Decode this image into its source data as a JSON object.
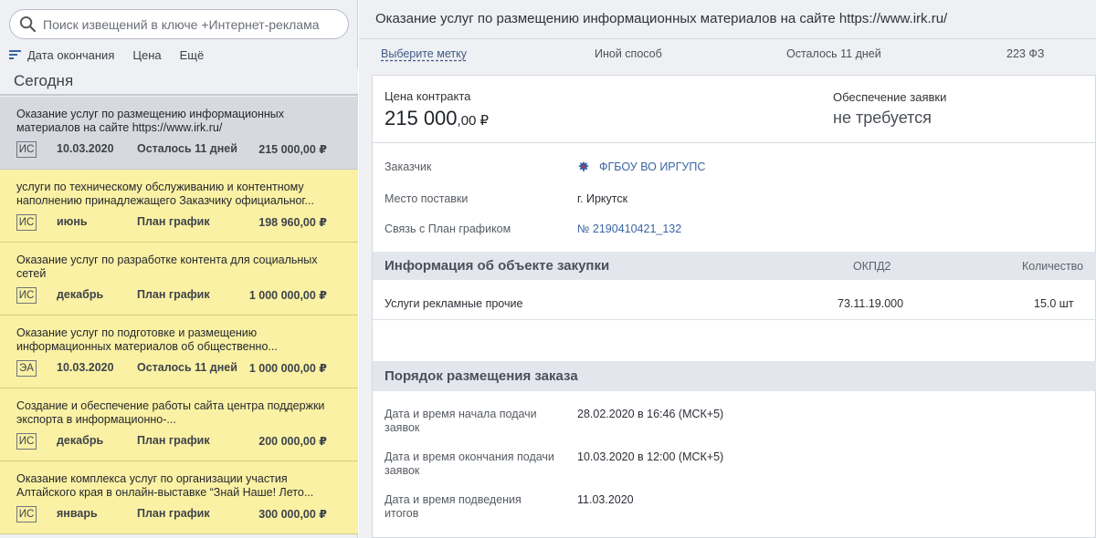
{
  "search": {
    "placeholder": "Поиск извещений в ключе +Интернет-реклама",
    "value": ""
  },
  "sortbar": {
    "sort_label": "Дата окончания",
    "price_label": "Цена",
    "more_label": "Ещё"
  },
  "list_header": "Сегодня",
  "cards": [
    {
      "title": "Оказание услуг по размещению информационных материалов на сайте https://www.irk.ru/",
      "badge": "ИС",
      "date": "10.03.2020",
      "status": "Осталось 11 дней",
      "price": "215 000,00 ₽",
      "selected": true
    },
    {
      "title": "услуги по техническому обслуживанию и контентному наполнению принадлежащего Заказчику официальног...",
      "badge": "ИС",
      "date": "июнь",
      "status": "План график",
      "price": "198 960,00 ₽",
      "selected": false
    },
    {
      "title": "Оказание услуг по разработке контента для социальных сетей",
      "badge": "ИС",
      "date": "декабрь",
      "status": "План график",
      "price": "1 000 000,00 ₽",
      "selected": false
    },
    {
      "title": "Оказание услуг по подготовке и размещению информационных материалов об общественно...",
      "badge": "ЭА",
      "date": "10.03.2020",
      "status": "Осталось 11 дней",
      "price": "1 000 000,00 ₽",
      "selected": false
    },
    {
      "title": "Создание и обеспечение работы сайта центра поддержки экспорта в информационно-...",
      "badge": "ИС",
      "date": "декабрь",
      "status": "План график",
      "price": "200 000,00 ₽",
      "selected": false
    },
    {
      "title": "Оказание комплекса услуг по организации участия Алтайского края в онлайн-выставке “Знай Наше! Лето...",
      "badge": "ИС",
      "date": "январь",
      "status": "План график",
      "price": "300 000,00 ₽",
      "selected": false
    }
  ],
  "detail": {
    "title": "Оказание услуг по размещению информационных материалов на сайте https://www.irk.ru/",
    "tags": {
      "choose": "Выберите метку",
      "method": "Иной способ",
      "remaining": "Осталось 11 дней",
      "law": "223 ФЗ"
    },
    "price": {
      "label": "Цена контракта",
      "whole": "215 000",
      "fraction": ",00 ₽"
    },
    "security": {
      "label": "Обеспечение заявки",
      "value": "не требуется"
    },
    "customer": {
      "label": "Заказчик",
      "value": "ФГБОУ ВО ИРГУПС"
    },
    "delivery": {
      "label": "Место поставки",
      "value": "г. Иркутск"
    },
    "plan_link": {
      "label": "Связь с План графиком",
      "value": "№ 2190410421_132"
    },
    "object_section": {
      "title": "Информация об объекте закупки",
      "col_okpd": "ОКПД2",
      "col_qty": "Количество"
    },
    "object_row": {
      "name": "Услуги рекламные прочие",
      "okpd": "73.11.19.000",
      "qty": "15.0 шт"
    },
    "order_section": {
      "title": "Порядок размещения заказа"
    },
    "order": [
      {
        "label": "Дата и время начала подачи заявок",
        "value": "28.02.2020 в 16:46 (МСК+5)"
      },
      {
        "label": "Дата и время окончания подачи заявок",
        "value": "10.03.2020 в 12:00 (МСК+5)"
      },
      {
        "label": "Дата и время подведения итогов",
        "value": "11.03.2020"
      }
    ]
  },
  "colors": {
    "card_bg": "#fbf1a4",
    "selected_bg": "#d6d9df",
    "link": "#3b64a3",
    "section_bg": "#e3e7ed"
  },
  "icons": {
    "search": "search-icon",
    "sort": "sort-lines-icon",
    "emblem": "eagle-emblem-icon"
  }
}
